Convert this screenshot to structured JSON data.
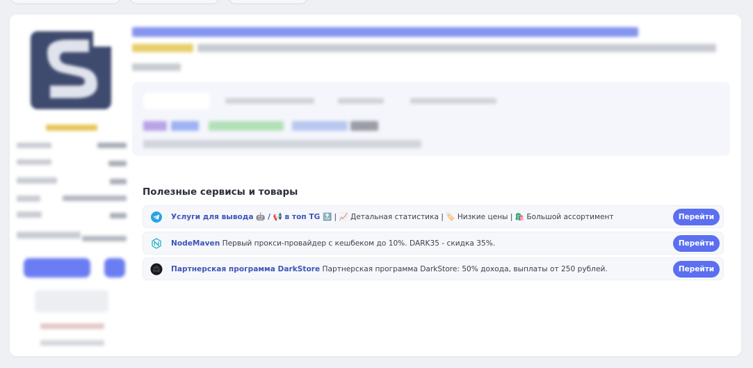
{
  "services": {
    "title": "Полезные сервисы и товары",
    "items": [
      {
        "icon": "telegram-icon",
        "name": "Услуги для вывода 🤖 / 📢 в топ TG 🔝",
        "description": " | 📈 Детальная статистика | 🏷️ Низкие цены | 🛍️ Большой ассортимент",
        "button": "Перейти"
      },
      {
        "icon": "nodemaven-icon",
        "name": "NodeMaven",
        "description": " Первый прокси-провайдер с кешбеком до 10%. DARK35 - скидка 35%.",
        "button": "Перейти"
      },
      {
        "icon": "darkstore-icon",
        "name": "Партнерская программа DarkStore",
        "description": " Партнерская программа DarkStore: 50% дохода, выплаты от 250 рублей.",
        "button": "Перейти"
      }
    ]
  },
  "colors": {
    "accent": "#5b6ff0",
    "link": "#3f55b8",
    "page_bg": "#eef0f4"
  }
}
